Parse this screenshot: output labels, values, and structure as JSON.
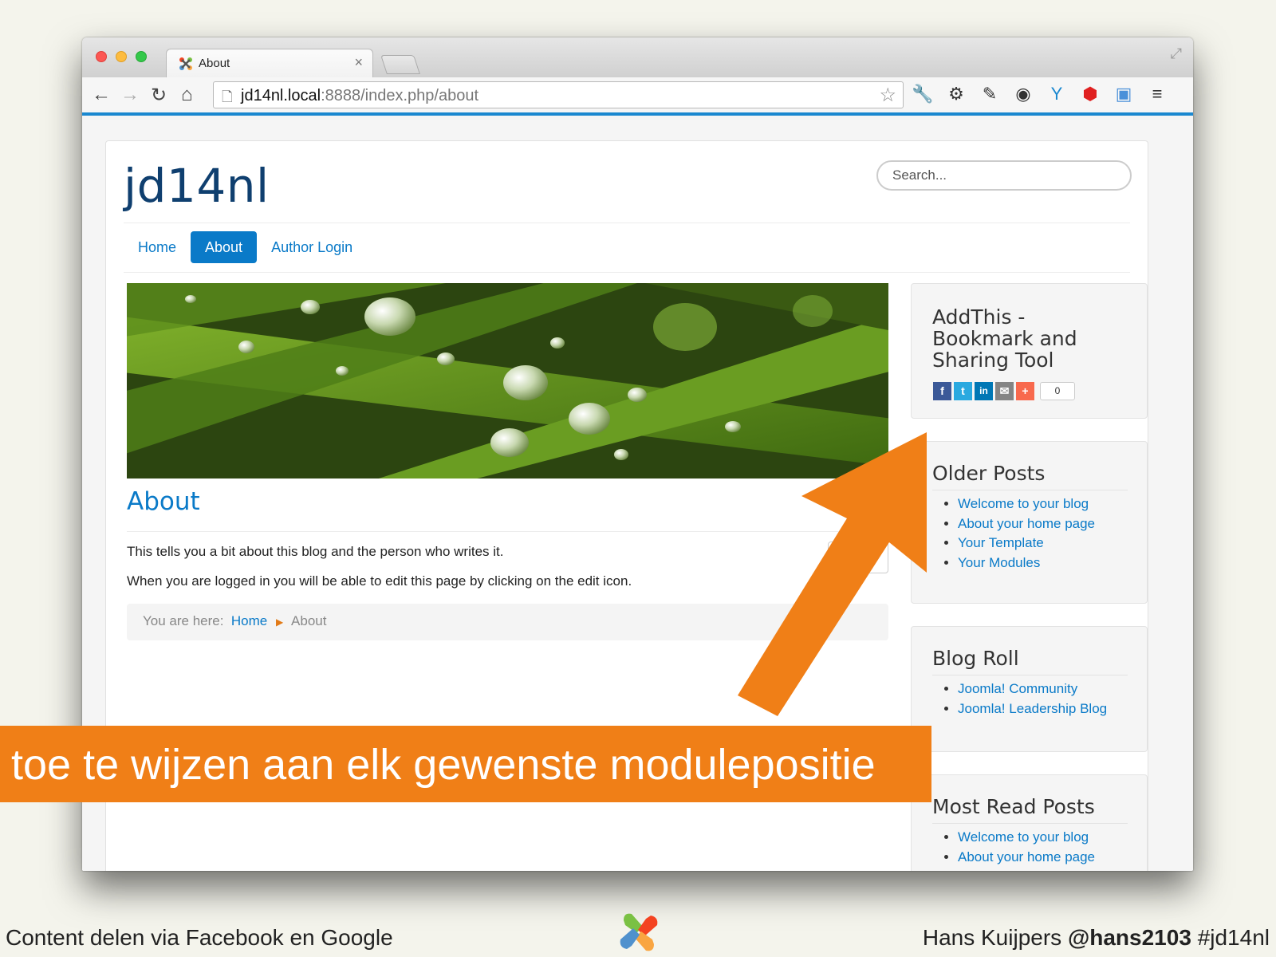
{
  "browser": {
    "tab_title": "About",
    "tab_close": "×",
    "url_host": "jd14nl.local",
    "url_path": ":8888/index.php/about"
  },
  "site": {
    "title": "jd14nl",
    "search_placeholder": "Search...",
    "menu": [
      {
        "label": "Home"
      },
      {
        "label": "About"
      },
      {
        "label": "Author Login"
      }
    ]
  },
  "article": {
    "title": "About",
    "paragraphs": [
      "This tells you a bit about this blog and the person who writes it.",
      "When you are logged in you will be able to edit this page by clicking on the edit icon."
    ],
    "breadcrumb": {
      "prefix": "You are here:",
      "home": "Home",
      "current": "About"
    }
  },
  "sidebar": {
    "addthis": {
      "title_lines": [
        "AddThis -",
        "Bookmark and",
        "Sharing Tool"
      ],
      "share_count": "0"
    },
    "older_posts": {
      "title": "Older Posts",
      "items": [
        "Welcome to your blog",
        "About your home page",
        "Your Template",
        "Your Modules"
      ]
    },
    "blog_roll": {
      "title": "Blog Roll",
      "items": [
        "Joomla! Community",
        "Joomla! Leadership Blog"
      ]
    },
    "most_read": {
      "title": "Most Read Posts",
      "items": [
        "Welcome to your blog",
        "About your home page"
      ]
    }
  },
  "slide": {
    "banner": "toe te wijzen aan elk gewenste modulepositie",
    "footer_left": "Content delen via Facebook en Google",
    "footer_author": "Hans Kuijpers",
    "footer_handle": "@hans2103",
    "footer_tag": "#jd14nl"
  },
  "colors": {
    "accent_orange": "#f07f17",
    "link_blue": "#0a7ac8",
    "toolbar_blue": "#1a88d0"
  },
  "icons": [
    "back-icon",
    "forward-icon",
    "reload-icon",
    "home-icon",
    "page-icon",
    "star-icon",
    "wrench-icon",
    "gear-icon",
    "joomla-logo-icon"
  ]
}
